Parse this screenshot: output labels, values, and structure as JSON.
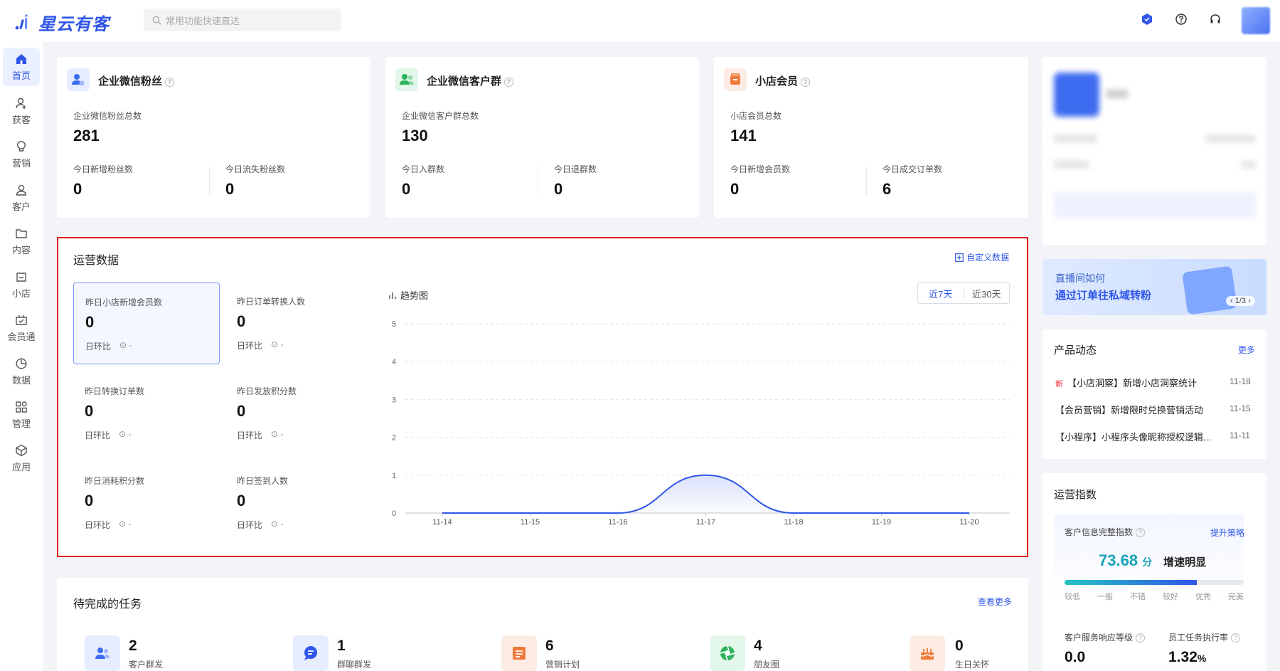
{
  "app": {
    "brand": "星云有客",
    "search_placeholder": "常用功能快速直达",
    "accent": "#2f56e8"
  },
  "sidebar": {
    "items": [
      {
        "label": "首页",
        "icon": "home-icon",
        "active": true
      },
      {
        "label": "获客",
        "icon": "user-add-icon"
      },
      {
        "label": "营销",
        "icon": "bulb-icon"
      },
      {
        "label": "客户",
        "icon": "user-icon"
      },
      {
        "label": "内容",
        "icon": "folder-icon"
      },
      {
        "label": "小店",
        "icon": "shop-icon"
      },
      {
        "label": "会员通",
        "icon": "member-icon"
      },
      {
        "label": "数据",
        "icon": "pie-icon"
      },
      {
        "label": "管理",
        "icon": "apps-icon"
      },
      {
        "label": "应用",
        "icon": "cube-icon"
      }
    ]
  },
  "summary_cards": [
    {
      "title": "企业微信粉丝",
      "total_label": "企业微信粉丝总数",
      "total": "281",
      "a_label": "今日新增粉丝数",
      "a": "0",
      "b_label": "今日流失粉丝数",
      "b": "0"
    },
    {
      "title": "企业微信客户群",
      "total_label": "企业微信客户群总数",
      "total": "130",
      "a_label": "今日入群数",
      "a": "0",
      "b_label": "今日退群数",
      "b": "0"
    },
    {
      "title": "小店会员",
      "total_label": "小店会员总数",
      "total": "141",
      "a_label": "今日新增会员数",
      "a": "0",
      "b_label": "今日成交订单数",
      "b": "6"
    }
  ],
  "ops": {
    "title": "运营数据",
    "custom_link": "自定义数据",
    "compare_label": "日环比",
    "compare_value": "-",
    "metrics": [
      {
        "label": "昨日小店新增会员数",
        "value": "0"
      },
      {
        "label": "昨日订单转换人数",
        "value": "0"
      },
      {
        "label": "昨日转换订单数",
        "value": "0"
      },
      {
        "label": "昨日发放积分数",
        "value": "0"
      },
      {
        "label": "昨日消耗积分数",
        "value": "0"
      },
      {
        "label": "昨日签到人数",
        "value": "0"
      }
    ],
    "trend_title": "趋势图",
    "range_options": [
      "近7天",
      "近30天"
    ],
    "range_selected": "近7天"
  },
  "chart_data": {
    "type": "area",
    "categories": [
      "11-14",
      "11-15",
      "11-16",
      "11-17",
      "11-18",
      "11-19",
      "11-20"
    ],
    "series": [
      {
        "values": [
          0,
          0,
          0,
          1,
          0,
          0,
          0
        ]
      }
    ],
    "yticks": [
      "0",
      "1",
      "2",
      "3",
      "4",
      "5"
    ],
    "ylim": [
      0,
      5
    ],
    "grid": true,
    "color": "#2f56e8"
  },
  "tasks": {
    "title": "待完成的任务",
    "more": "查看更多",
    "items": [
      {
        "count": "2",
        "label": "客户群发",
        "icon": "users-icon",
        "color": "#3d6cf0"
      },
      {
        "count": "1",
        "label": "群聊群发",
        "icon": "chat-icon",
        "color": "#2f56e8"
      },
      {
        "count": "6",
        "label": "营销计划",
        "icon": "plan-icon",
        "color": "#f07a3a"
      },
      {
        "count": "4",
        "label": "朋友圈",
        "icon": "moments-icon",
        "color": "#2bb35a"
      },
      {
        "count": "0",
        "label": "生日关怀",
        "icon": "cake-icon",
        "color": "#f07a3a"
      }
    ]
  },
  "banner": {
    "line1": "直播间如何",
    "line2": "通过订单往私域转粉",
    "pager": "1/3"
  },
  "news": {
    "title": "产品动态",
    "more": "更多",
    "items": [
      {
        "badge": "新",
        "text": "【小店洞察】新增小店洞察统计",
        "date": "11-18"
      },
      {
        "text": "【会员营销】新增限时兑换营销活动",
        "date": "11-15"
      },
      {
        "text": "【小程序】小程序头像昵称授权逻辑...",
        "date": "11-11"
      }
    ]
  },
  "ops_index": {
    "title": "运营指数",
    "info_label": "客户信息完整指数",
    "improve": "提升策略",
    "score": "73.68",
    "score_unit": "分",
    "status": "增速明显",
    "score_fraction": 0.74,
    "levels": [
      "较低",
      "一般",
      "不错",
      "较好",
      "优秀",
      "完美"
    ],
    "resp_label": "客户服务响应等级",
    "resp_value": "0.0",
    "exec_label": "员工任务执行率",
    "exec_value": "1.32",
    "exec_unit": "%"
  }
}
